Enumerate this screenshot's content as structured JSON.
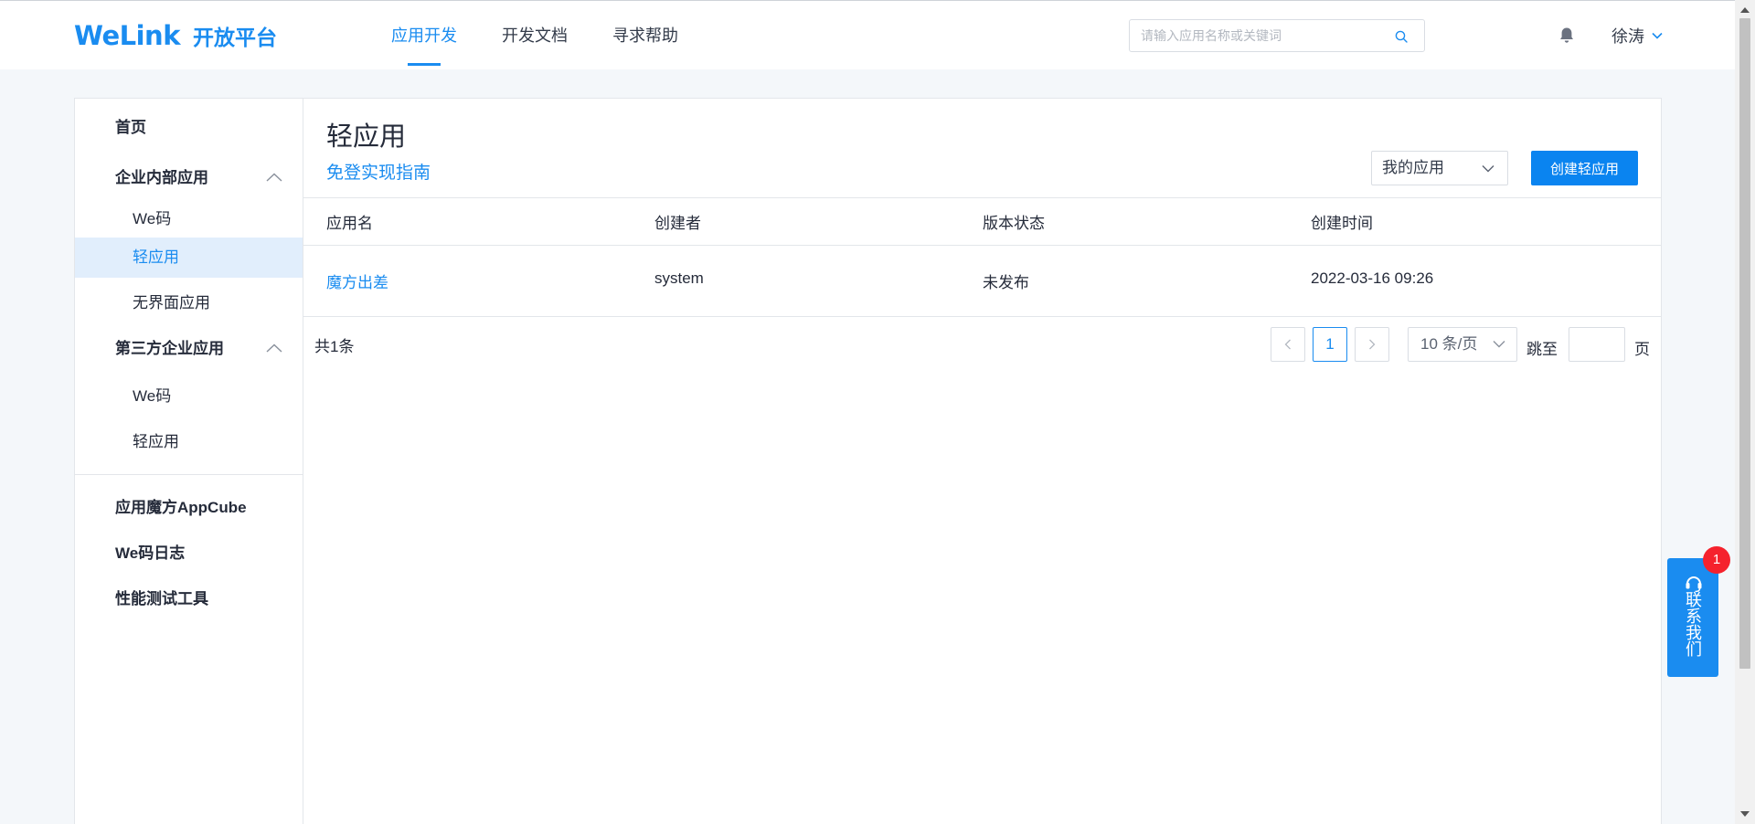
{
  "header": {
    "logo_mark": "WeLink",
    "logo_sub": "开放平台",
    "nav": [
      {
        "label": "应用开发"
      },
      {
        "label": "开发文档"
      },
      {
        "label": "寻求帮助"
      }
    ],
    "search_placeholder": "请输入应用名称或关键词",
    "user_name": "徐涛"
  },
  "sidebar": {
    "home": "首页",
    "group_internal": "企业内部应用",
    "internal_items": [
      "We码",
      "轻应用",
      "无界面应用"
    ],
    "group_third_party": "第三方企业应用",
    "third_party_items": [
      "We码",
      "轻应用"
    ],
    "bottom_items": [
      "应用魔方AppCube",
      "We码日志",
      "性能测试工具"
    ]
  },
  "main": {
    "title": "轻应用",
    "guide_link": "免登实现指南",
    "filter_selected": "我的应用",
    "create_button": "创建轻应用",
    "columns": [
      "应用名",
      "创建者",
      "版本状态",
      "创建时间"
    ],
    "rows": [
      {
        "name": "魔方出差",
        "creator": "system",
        "status": "未发布",
        "created": "2022-03-16 09:26"
      }
    ],
    "pagination": {
      "total": "共1条",
      "current_page": "1",
      "page_size": "10 条/页",
      "jump_label": "跳至",
      "page_unit": "页"
    }
  },
  "contact": {
    "label": "联系我们",
    "badge": "1"
  },
  "colors": {
    "accent": "#1a8cf0",
    "badge": "#f5222d",
    "selected_bg": "#e1eefc"
  }
}
